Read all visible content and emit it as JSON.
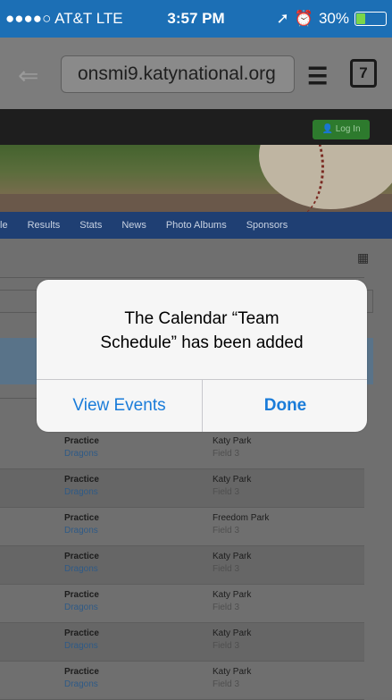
{
  "status_bar": {
    "carrier": "●●●●○ AT&T  LTE",
    "time": "3:57 PM",
    "battery": "30%",
    "battery_level": 0.3
  },
  "browser": {
    "url": "onsmi9.katynational.org",
    "tab_count": "7"
  },
  "site": {
    "login_label": "Log In",
    "nav_items": [
      "le",
      "Results",
      "Stats",
      "News",
      "Photo Albums",
      "Sponsors"
    ]
  },
  "alert": {
    "message_line1": "The Calendar “Team",
    "message_line2": "Schedule” has been added",
    "view_events": "View Events",
    "done": "Done"
  },
  "schedule": [
    {
      "title": "Practice",
      "team": "Dragons",
      "location": "Katy Park",
      "field": "Field 3"
    },
    {
      "title": "Practice",
      "team": "Dragons",
      "location": "Katy Park",
      "field": "Field 3"
    },
    {
      "title": "Practice",
      "team": "Dragons",
      "location": "Freedom Park",
      "field": "Field 3"
    },
    {
      "title": "Practice",
      "team": "Dragons",
      "location": "Katy Park",
      "field": "Field 3"
    },
    {
      "title": "Practice",
      "team": "Dragons",
      "location": "Katy Park",
      "field": "Field 3"
    },
    {
      "title": "Practice",
      "team": "Dragons",
      "location": "Katy Park",
      "field": "Field 3"
    },
    {
      "title": "Practice",
      "team": "Dragons",
      "location": "Katy Park",
      "field": "Field 3"
    }
  ]
}
